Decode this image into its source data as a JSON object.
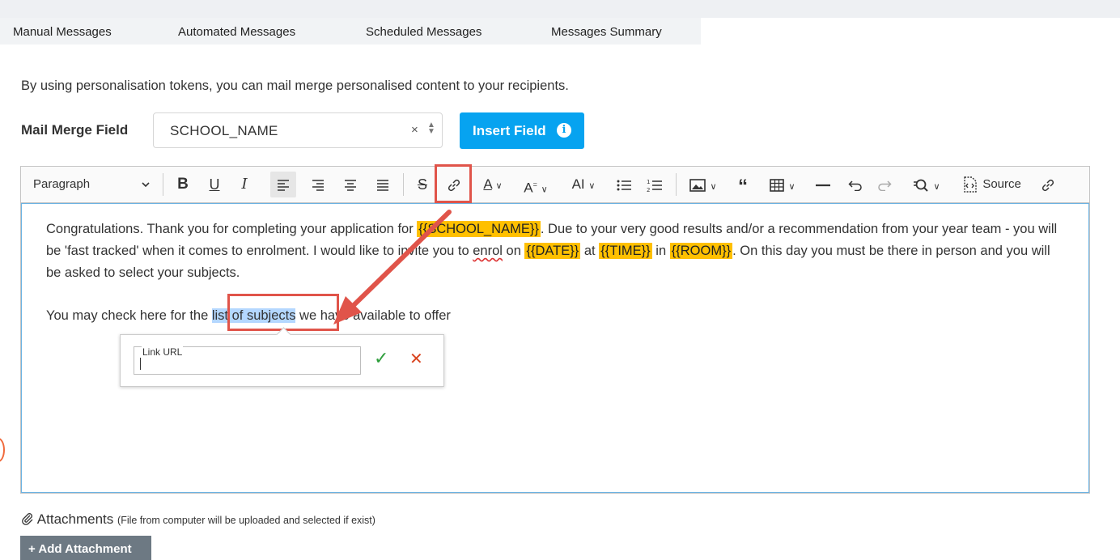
{
  "tabs": [
    "Manual Messages",
    "Automated Messages",
    "Scheduled Messages",
    "Messages Summary"
  ],
  "intro_text": "By using personalisation tokens, you can mail merge personalised content to your recipients.",
  "mail_merge": {
    "label": "Mail Merge Field",
    "selected": "SCHOOL_NAME",
    "clear": "×",
    "insert_button": "Insert Field",
    "info_glyph": "i"
  },
  "toolbar": {
    "paragraph_label": "Paragraph",
    "bold": "B",
    "underline": "U",
    "italic": "I",
    "font_size": "AI",
    "source_label": "Source",
    "icons": [
      "chevron-down-icon",
      "bold-icon",
      "underline-icon",
      "italic-icon",
      "align-left-icon",
      "align-right-icon",
      "align-center-icon",
      "align-justify-icon",
      "strikethrough-icon",
      "link-icon",
      "font-color-icon",
      "font-family-icon",
      "font-size-icon",
      "bulleted-list-icon",
      "numbered-list-icon",
      "image-icon",
      "blockquote-icon",
      "table-icon",
      "horizontal-line-icon",
      "undo-icon",
      "redo-icon",
      "find-replace-icon",
      "source-icon",
      "link-icon"
    ]
  },
  "content": {
    "p1_a": "Congratulations. Thank you for completing your application for ",
    "token_school": "{{SCHOOL_NAME}}",
    "p1_b": ". Due to your very good results and/or a recommendation from your year team - you will be 'fast tracked' when it comes to enrolment. I would like to invite you to ",
    "enrol": "enrol",
    "p1_c": " on ",
    "token_date": "{{DATE}}",
    "p1_d": " at ",
    "token_time": "{{TIME}}",
    "p1_e": " in ",
    "token_room": "{{ROOM}}",
    "p1_f": ". On this day you must be there in person and you will be asked to select your subjects.",
    "p2_a": "You may check here for the ",
    "selected_text": "list of subjects",
    "p2_b": " we have available to offer"
  },
  "link_popup": {
    "label": "Link URL",
    "value": "",
    "confirm_glyph": "✓",
    "cancel_glyph": "✕"
  },
  "attachments": {
    "label": "Attachments",
    "note": "(File from computer will be uploaded and selected if exist)",
    "add_button": "+ Add Attachment"
  },
  "colors": {
    "accent": "#06a3f0",
    "token": "#ffc000",
    "selection": "#b4d7ff",
    "highlight": "#e0544a",
    "confirm": "#2e9e3c",
    "cancel": "#d9441f",
    "button_gray": "#6d7983"
  }
}
